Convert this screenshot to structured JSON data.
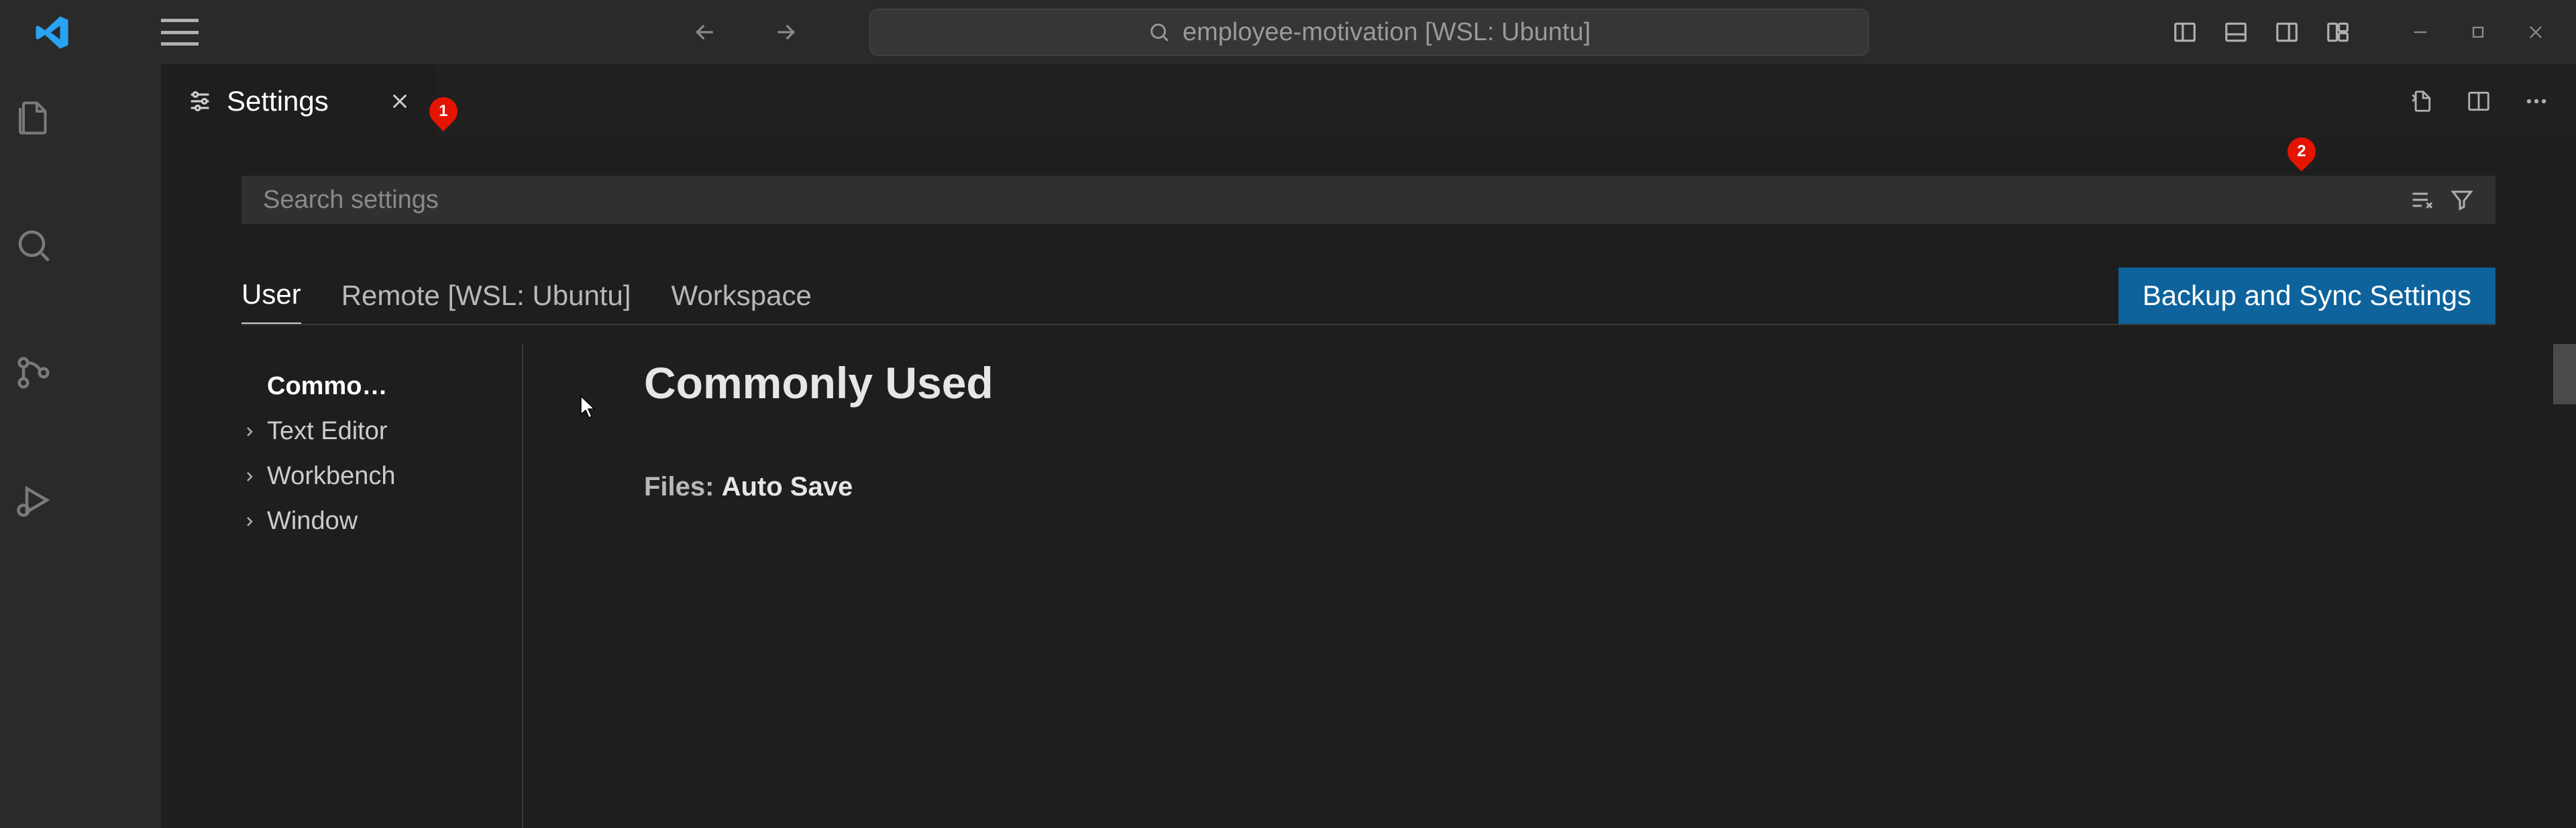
{
  "titlebar": {
    "search_text": "employee-motivation [WSL: Ubuntu]"
  },
  "tab": {
    "label": "Settings"
  },
  "settings": {
    "search_placeholder": "Search settings",
    "scopes": {
      "user": "User",
      "remote": "Remote [WSL: Ubuntu]",
      "workspace": "Workspace"
    },
    "backup_button": "Backup and Sync Settings",
    "toc": {
      "commonly_used": "Commo…",
      "text_editor": "Text Editor",
      "workbench": "Workbench",
      "window": "Window"
    },
    "content": {
      "section_title": "Commonly Used",
      "setting_prefix": "Files: ",
      "setting_name": "Auto Save"
    }
  },
  "badges": {
    "b1": "1",
    "b2": "2"
  }
}
